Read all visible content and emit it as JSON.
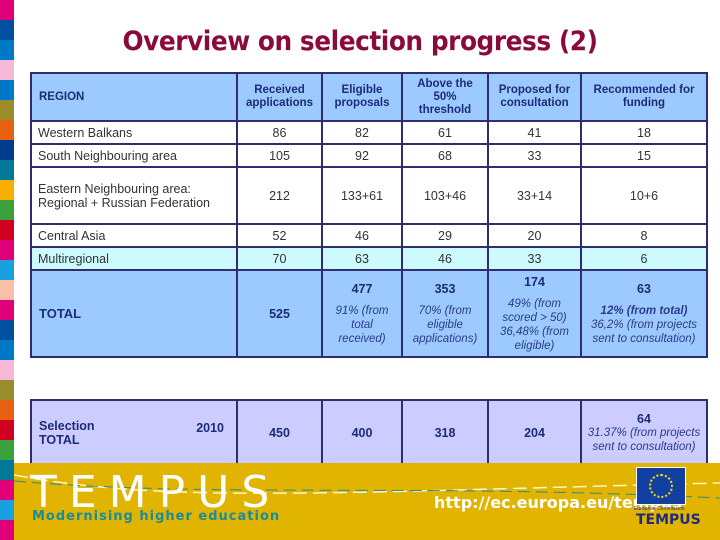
{
  "title": "Overview on selection progress (2)",
  "strip_colors": [
    "#e0007a",
    "#0050a0",
    "#0078c8",
    "#f5b8d6",
    "#0078c8",
    "#9a8c2a",
    "#e86010",
    "#003c8c",
    "#007898",
    "#f8b000",
    "#3aa03c",
    "#d00020",
    "#e0007a",
    "#18a0e0",
    "#f8c0a8",
    "#e0007a",
    "#0050a0",
    "#0078c8",
    "#f5b8d6",
    "#9a8c2a",
    "#e86010",
    "#d00020",
    "#3aa03c",
    "#007898",
    "#e0007a",
    "#18a0e0",
    "#e0007a"
  ],
  "table": {
    "headers": [
      "REGION",
      "Received applications",
      "Eligible proposals",
      "Above the 50% threshold",
      "Proposed for consultation",
      "Recommended for funding"
    ],
    "rows": [
      {
        "region": "Western Balkans",
        "values": [
          "86",
          "82",
          "61",
          "41",
          "18"
        ]
      },
      {
        "region": "South Neighbouring area",
        "values": [
          "105",
          "92",
          "68",
          "33",
          "15"
        ]
      },
      {
        "region": "Eastern Neighbouring area: Regional + Russian Federation",
        "values": [
          "212",
          "133+61",
          "103+46",
          "33+14",
          "10+6"
        ]
      },
      {
        "region": "Central Asia",
        "values": [
          "52",
          "46",
          "29",
          "20",
          "8"
        ]
      },
      {
        "region": "Multiregional",
        "values": [
          "70",
          "63",
          "46",
          "33",
          "6"
        ]
      }
    ],
    "total": {
      "label": "TOTAL",
      "received": "525",
      "eligible": {
        "value": "477",
        "note": "91% (from total received)"
      },
      "threshold": {
        "value": "353",
        "note": "70% (from eligible applications)"
      },
      "consultation": {
        "value": "174",
        "note": "49% (from scored > 50) 36,48% (from eligible)"
      },
      "funding": {
        "value": "63",
        "note_bold": "12% (from total)",
        "note": "36,2% (from projects sent to consultation)"
      }
    }
  },
  "selection_total": {
    "label": "Selection TOTAL",
    "year": "2010",
    "values": [
      "450",
      "400",
      "318",
      "204"
    ],
    "funding": {
      "value": "64",
      "note": "31.37% (from projects sent to consultation)"
    }
  },
  "footer": {
    "brand": "TEMPUS",
    "tagline": "Modernising higher education",
    "url": "http://ec.europa.eu/tempus",
    "ec_label": "European Commission",
    "ec_brand": "TEMPUS"
  }
}
